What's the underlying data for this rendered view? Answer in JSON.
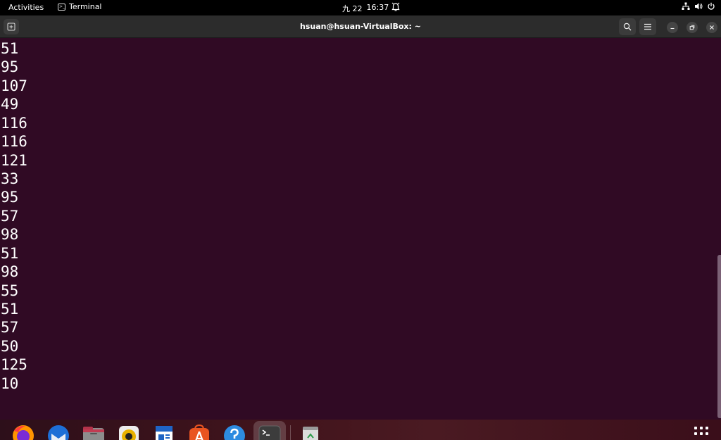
{
  "topbar": {
    "activities": "Activities",
    "app_name": "Terminal",
    "date": "九 22",
    "time": "16:37",
    "icons": [
      "alarm-icon",
      "network-icon",
      "volume-icon",
      "power-icon"
    ]
  },
  "header": {
    "title": "hsuan@hsuan-VirtualBox: ~",
    "icons": [
      "new-tab-icon",
      "search-icon",
      "hamburger-menu-icon",
      "minimize-icon",
      "restore-icon",
      "close-icon"
    ]
  },
  "terminal": {
    "lines": [
      "51",
      "95",
      "107",
      "49",
      "116",
      "116",
      "121",
      "33",
      "95",
      "57",
      "98",
      "51",
      "98",
      "55",
      "51",
      "57",
      "50",
      "125",
      "10"
    ],
    "background": "#300a24",
    "foreground": "#ffffff"
  },
  "dock": {
    "apps": [
      "firefox-icon",
      "thunderbird-icon",
      "files-icon",
      "rhythmbox-icon",
      "libreoffice-writer-icon",
      "app-center-icon",
      "help-icon",
      "terminal-icon",
      "trash-icon",
      "show-apps-icon"
    ],
    "active_app": "terminal-icon"
  }
}
